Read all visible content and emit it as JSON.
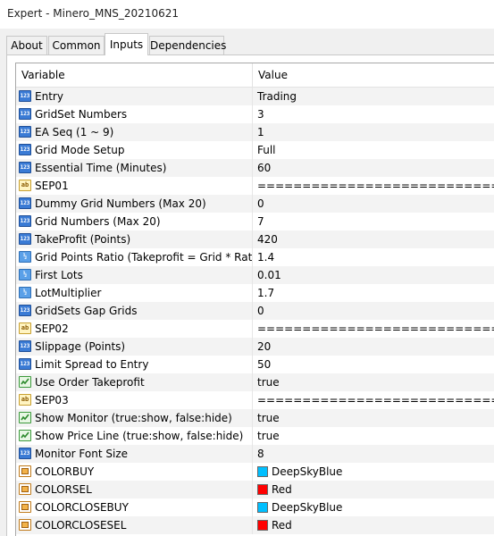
{
  "window": {
    "title": "Expert - Minero_MNS_20210621"
  },
  "tabs": [
    {
      "label": "About"
    },
    {
      "label": "Common"
    },
    {
      "label": "Inputs",
      "active": true
    },
    {
      "label": "Dependencies"
    }
  ],
  "table": {
    "col_variable": "Variable",
    "col_value": "Value",
    "rows": [
      {
        "variable": "Entry",
        "value": "Trading",
        "type": "int-icon"
      },
      {
        "variable": "GridSet Numbers",
        "value": "3",
        "type": "int-icon"
      },
      {
        "variable": "EA Seq (1 ~ 9)",
        "value": "1",
        "type": "int-icon"
      },
      {
        "variable": "Grid Mode Setup",
        "value": "Full",
        "type": "int-icon"
      },
      {
        "variable": "Essential Time (Minutes)",
        "value": "60",
        "type": "int-icon"
      },
      {
        "variable": "SEP01",
        "value": "====================================",
        "type": "string-icon"
      },
      {
        "variable": "Dummy Grid Numbers (Max 20)",
        "value": "0",
        "type": "int-icon"
      },
      {
        "variable": "Grid Numbers (Max 20)",
        "value": "7",
        "type": "int-icon"
      },
      {
        "variable": "TakeProfit (Points)",
        "value": "420",
        "type": "int-icon"
      },
      {
        "variable": "Grid Points Ratio (Takeprofit = Grid * Ratio)",
        "value": "1.4",
        "type": "double-icon"
      },
      {
        "variable": "First Lots",
        "value": "0.01",
        "type": "double-icon"
      },
      {
        "variable": "LotMultiplier",
        "value": "1.7",
        "type": "double-icon"
      },
      {
        "variable": "GridSets Gap Grids",
        "value": "0",
        "type": "int-icon"
      },
      {
        "variable": "SEP02",
        "value": "====================================",
        "type": "string-icon"
      },
      {
        "variable": "Slippage (Points)",
        "value": "20",
        "type": "int-icon"
      },
      {
        "variable": "Limit Spread to Entry",
        "value": "50",
        "type": "int-icon"
      },
      {
        "variable": "Use Order Takeprofit",
        "value": "true",
        "type": "bool-icon"
      },
      {
        "variable": "SEP03",
        "value": "====================================",
        "type": "string-icon"
      },
      {
        "variable": "Show Monitor (true:show, false:hide)",
        "value": "true",
        "type": "bool-icon"
      },
      {
        "variable": "Show Price Line (true:show, false:hide)",
        "value": "true",
        "type": "bool-icon"
      },
      {
        "variable": "Monitor Font Size",
        "value": "8",
        "type": "int-icon"
      },
      {
        "variable": "COLORBUY",
        "value": "DeepSkyBlue",
        "type": "color-icon",
        "swatch": "#00bfff"
      },
      {
        "variable": "COLORSEL",
        "value": "Red",
        "type": "color-icon",
        "swatch": "#ff0000"
      },
      {
        "variable": "COLORCLOSEBUY",
        "value": "DeepSkyBlue",
        "type": "color-icon",
        "swatch": "#00bfff"
      },
      {
        "variable": "COLORCLOSESEL",
        "value": "Red",
        "type": "color-icon",
        "swatch": "#ff0000"
      }
    ]
  }
}
